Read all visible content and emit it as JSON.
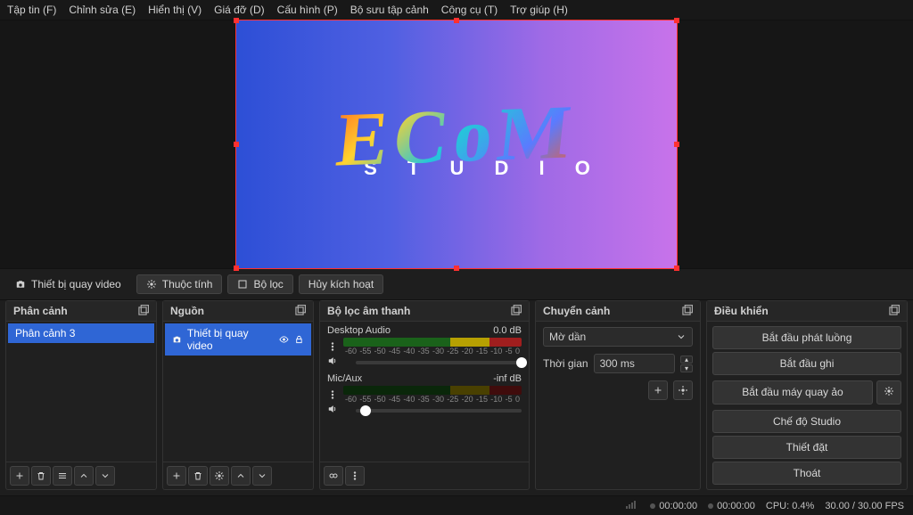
{
  "menu": {
    "file": "Tập tin (F)",
    "edit": "Chỉnh sửa (E)",
    "view": "Hiển thị (V)",
    "dock": "Giá đỡ (D)",
    "profile": "Cấu hình (P)",
    "scenes": "Bộ sưu tập cảnh",
    "tools": "Công cụ (T)",
    "help": "Trợ giúp (H)"
  },
  "preview": {
    "logo_script": "ECoM",
    "logo_sub": "S T U D I O"
  },
  "ctx": {
    "source_label": "Thiết bị quay video",
    "properties": "Thuộc tính",
    "filters": "Bộ lọc",
    "deactivate": "Hủy kích hoạt"
  },
  "scenes": {
    "title": "Phân cảnh",
    "items": [
      "Phân cảnh 3"
    ]
  },
  "sources": {
    "title": "Nguồn",
    "items": [
      {
        "label": "Thiết bị quay video",
        "visible": true,
        "locked": true
      }
    ]
  },
  "mixer": {
    "title": "Bộ lọc âm thanh",
    "ticks": [
      "-60",
      "-55",
      "-50",
      "-45",
      "-40",
      "-35",
      "-30",
      "-25",
      "-20",
      "-15",
      "-10",
      "-5",
      "0"
    ],
    "channels": [
      {
        "name": "Desktop Audio",
        "level": "0.0 dB",
        "active": true,
        "vol_pct": 100
      },
      {
        "name": "Mic/Aux",
        "level": "-inf dB",
        "active": false,
        "vol_pct": 6
      }
    ]
  },
  "transitions": {
    "title": "Chuyển cảnh",
    "selected": "Mờ dần",
    "duration_label": "Thời gian",
    "duration_value": "300 ms"
  },
  "controls": {
    "title": "Điều khiển",
    "stream": "Bắt đầu phát luồng",
    "record": "Bắt đầu ghi",
    "vcam": "Bắt đầu máy quay ảo",
    "studio": "Chế độ Studio",
    "settings": "Thiết đặt",
    "exit": "Thoát"
  },
  "status": {
    "live_time": "00:00:00",
    "rec_time": "00:00:00",
    "cpu": "CPU: 0.4%",
    "fps": "30.00 / 30.00 FPS"
  }
}
